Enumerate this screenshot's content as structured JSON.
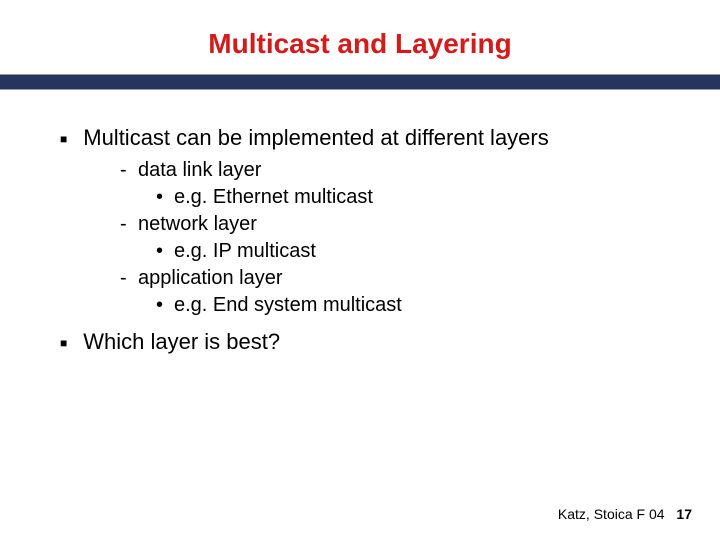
{
  "title": "Multicast and Layering",
  "points": {
    "p1": "Multicast can be implemented at different layers",
    "p2": "Which layer is best?"
  },
  "layers": {
    "l1": {
      "name": "data link layer",
      "ex": "e.g. Ethernet multicast"
    },
    "l2": {
      "name": "network layer",
      "ex": "e.g. IP multicast"
    },
    "l3": {
      "name": "application layer",
      "ex": "e.g. End system multicast"
    }
  },
  "footer": {
    "credit": "Katz, Stoica F 04",
    "page": "17"
  },
  "glyphs": {
    "square": "■",
    "dash": "-",
    "dot": "•"
  }
}
